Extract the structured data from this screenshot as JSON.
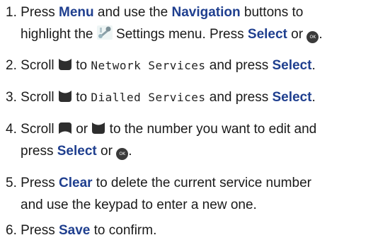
{
  "steps": [
    {
      "num": "1.",
      "l1_pre": "Press ",
      "btn_menu": "Menu",
      "l1_mid": " and use the ",
      "btn_nav": "Navigation",
      "l1_post": " buttons to",
      "l2_pre": "highlight the ",
      "l2_mid": " Settings menu. Press ",
      "btn_select": "Select",
      "l2_or": " or ",
      "l2_end": "."
    },
    {
      "num": "2.",
      "pre": "Scroll ",
      "mid": " to ",
      "lcd": "Network Services",
      "post": " and press ",
      "btn_select": "Select",
      "end": "."
    },
    {
      "num": "3.",
      "pre": "Scroll ",
      "mid": " to ",
      "lcd": "Dialled Services",
      "post": " and press ",
      "btn_select": "Select",
      "end": "."
    },
    {
      "num": "4.",
      "pre": "Scroll ",
      "or": " or ",
      "post": " to the number you want to edit and",
      "l2_pre": "press ",
      "btn_select": "Select",
      "l2_or": " or ",
      "l2_end": "."
    },
    {
      "num": "5.",
      "pre": "Press ",
      "btn_clear": "Clear",
      "post": " to delete the current service number",
      "l2": "and use the keypad to enter a new one."
    },
    {
      "num": "6.",
      "pre": "Press ",
      "btn_save": "Save",
      "post": " to confirm."
    }
  ],
  "ok_label": "OK",
  "icons": [
    "settings-icon",
    "scroll-down-icon",
    "scroll-up-icon",
    "ok-button-icon"
  ],
  "colors": {
    "button_text": "#1f3f8f",
    "body_text": "#1a1a1a"
  }
}
